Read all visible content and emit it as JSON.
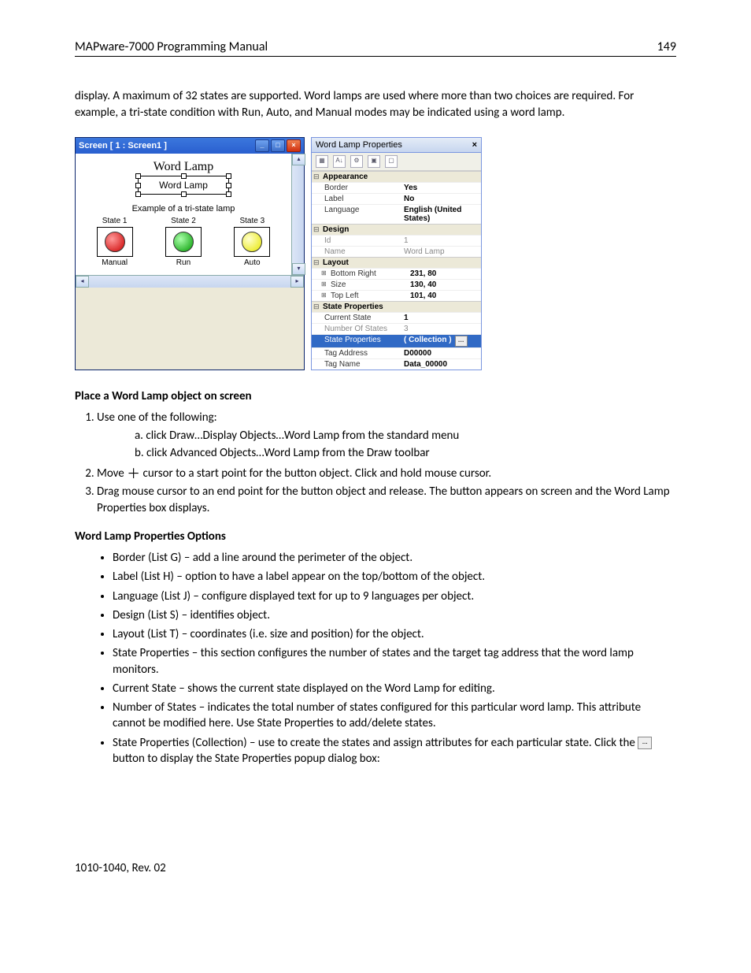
{
  "header": {
    "title": "MAPware-7000 Programming Manual",
    "page": "149"
  },
  "intro": "display.  A maximum of 32 states are supported.  Word lamps are used where more than two choices are required. For example, a tri-state condition with Run, Auto, and Manual modes may be indicated using a word lamp.",
  "screenWindow": {
    "title": "Screen  [ 1  :  Screen1 ]",
    "heading": "Word Lamp",
    "boxLabel": "Word Lamp",
    "caption": "Example of a tri-state lamp",
    "states": [
      {
        "head": "State 1",
        "foot": "Manual",
        "color": "red"
      },
      {
        "head": "State 2",
        "foot": "Run",
        "color": "green"
      },
      {
        "head": "State 3",
        "foot": "Auto",
        "color": "yellow"
      }
    ]
  },
  "propsPanel": {
    "title": "Word Lamp Properties",
    "categories": [
      {
        "name": "Appearance",
        "rows": [
          {
            "k": "Border",
            "v": "Yes"
          },
          {
            "k": "Label",
            "v": "No"
          },
          {
            "k": "Language",
            "v": "English (United States)"
          }
        ]
      },
      {
        "name": "Design",
        "rows": [
          {
            "k": "Id",
            "v": "1",
            "dim": true
          },
          {
            "k": "Name",
            "v": "Word Lamp",
            "dim": true
          }
        ]
      },
      {
        "name": "Layout",
        "rows": [
          {
            "k": "Bottom Right",
            "v": "231, 80",
            "sub": true
          },
          {
            "k": "Size",
            "v": "130, 40",
            "sub": true
          },
          {
            "k": "Top Left",
            "v": "101, 40",
            "sub": true
          }
        ]
      },
      {
        "name": "State Properties",
        "rows": [
          {
            "k": "Current State",
            "v": "1"
          },
          {
            "k": "Number Of States",
            "v": "3",
            "dim": true
          },
          {
            "k": "State Properties",
            "v": "( Collection )",
            "sel": true,
            "btn": true
          },
          {
            "k": "Tag Address",
            "v": "D00000"
          },
          {
            "k": "Tag Name",
            "v": "Data_00000"
          }
        ]
      }
    ]
  },
  "section1": {
    "title": "Place a Word Lamp object on screen",
    "step1": "Use one of the following:",
    "step1a": "a.    click Draw…Display Objects…Word Lamp from the standard menu",
    "step1b": "b.    click Advanced Objects…Word Lamp from the Draw toolbar",
    "step2a": "Move ",
    "step2b": " cursor to a start point for the button object. Click and hold mouse cursor.",
    "step3": "Drag mouse cursor to an end point for the button object and release. The button appears on screen and the Word Lamp Properties box displays."
  },
  "section2": {
    "title": "Word Lamp Properties Options",
    "bullets": [
      "Border (List G) – add a line around the perimeter of the object.",
      "Label (List H) – option to have a label appear on the top/bottom of the object.",
      "Language (List J) – configure displayed text for up to 9 languages per object.",
      "Design (List S) – identifies object.",
      "Layout (List T) – coordinates (i.e. size and position) for the object.",
      "State Properties – this section configures the number of states and the target tag address that the word lamp monitors.",
      "Current State – shows the current state displayed on the Word Lamp for editing.",
      "Number of States – indicates the total number of states configured for this particular word lamp.  This attribute cannot be modified here.  Use State Properties to add/delete states."
    ],
    "lastBulletA": "State Properties (Collection) – use to create the states and assign attributes for each particular state.  Click the ",
    "lastBulletB": " button to display the State Properties popup dialog box:"
  },
  "footer": "1010-1040, Rev. 02"
}
